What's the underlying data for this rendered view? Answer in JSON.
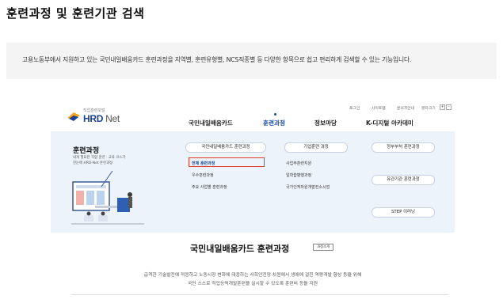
{
  "page": {
    "title": "훈련과정 및 훈련기관 검색",
    "description": "고용노동부에서 지원하고 있는 국민내일배움카드 훈련과정을 지역별, 훈련유형별, NCS직종별 등 다양한 항목으로 쉽고 편리하게 검색할 수 있는 기능입니다."
  },
  "site": {
    "logo_sub": "직업훈련포털",
    "logo_main": "HRD",
    "logo_net": "Net",
    "util": {
      "login": "로그인",
      "sitemap": "사이트맵",
      "contact": "문의처안내",
      "font": "글자크기",
      "plus": "+",
      "minus": "-"
    },
    "gnb": [
      "국민내일배움카드",
      "훈련과정",
      "정보마당",
      "K-디지털 아카데미"
    ],
    "panel": {
      "title": "훈련과정",
      "desc_line1": "내게 필요한 직업 훈련 · 교육 코스가",
      "desc_line2": "한눈에 HRD-Net 훈련과정",
      "categories": [
        "국민내일배움카드 훈련과정",
        "기업훈련 과정",
        "정부부처 훈련과정",
        "유관기관 훈련과정",
        "STEP 이러닝"
      ],
      "sub_items": [
        "전체 훈련과정",
        "우수훈련과정",
        "주요 사업별 훈련과정",
        "사업주훈련지원",
        "일학습병행과정",
        "국가인적자원개발컨소시엄"
      ]
    },
    "section": {
      "title": "국민내일배움카드 훈련과정",
      "tag": "과정소개",
      "desc_line1": "급격한 기술발전에 적응하고 노동시장 변화에 대응하는 사회안전망 차원에서 생애에 걸친 역량개발 향상 등을 위해",
      "desc_line2": "국민 스스로 직업능력개발훈련을 실시할 수 있도록 훈련비 등을 지원"
    }
  }
}
